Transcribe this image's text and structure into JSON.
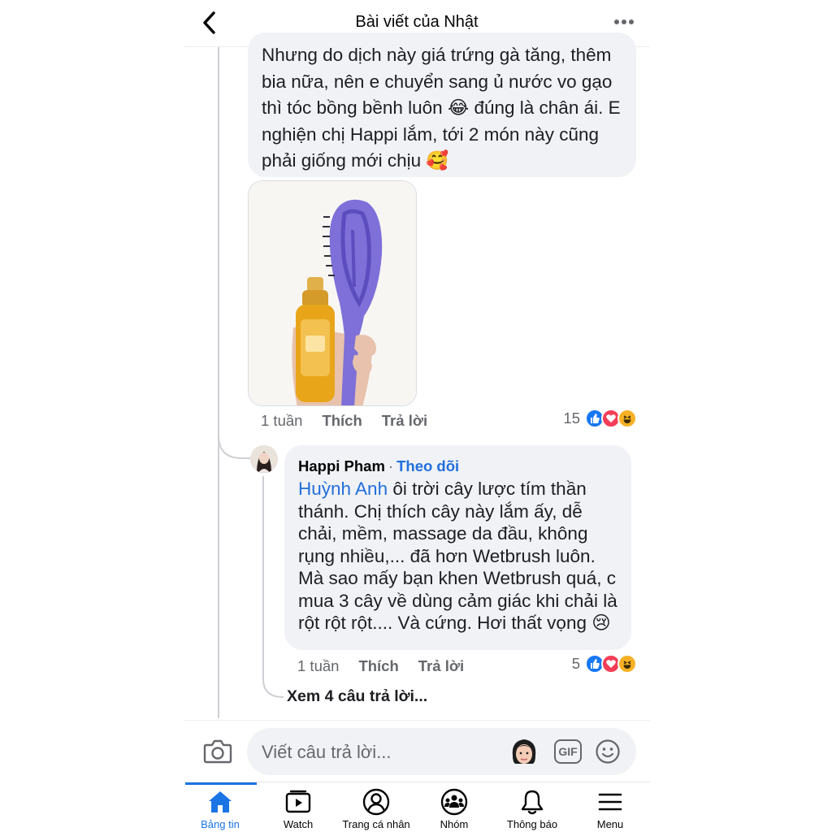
{
  "header": {
    "title": "Bài viết của Nhật",
    "back_icon": "chevron-left-icon",
    "more_icon": "more-horizontal-icon"
  },
  "comment1": {
    "text": "Nhưng do dịch này giá trứng gà tăng, thêm bia nữa, nên e chuyển sang ủ nước vo gạo thì tóc bồng bềnh luôn 😂 đúng là chân ái. E nghiện chị Happi lắm, tới 2 món này cũng phải giống mới chịu 🥰",
    "photo_icon": "photo-hair-oil-and-purple-brush",
    "time": "1 tuần",
    "like_label": "Thích",
    "reply_label": "Trả lời",
    "reaction_count": "15",
    "reactions": [
      "like",
      "love",
      "haha"
    ]
  },
  "comment2": {
    "author": "Happi Pham",
    "separator": "·",
    "follow_label": "Theo dõi",
    "mention": "Huỳnh Anh",
    "text": " ôi trời cây lược tím thần thánh. Chị thích cây này lắm ấy, dễ chải, mềm, massage da đầu, không rụng nhiều,... đã hơn Wetbrush luôn. Mà sao mấy bạn khen Wetbrush quá, c mua 3 cây về dùng cảm giác khi chải là rột rột rột.... Và cứng. Hơi thất vọng 😢",
    "time": "1 tuần",
    "like_label": "Thích",
    "reply_label": "Trả lời",
    "reaction_count": "5",
    "reactions": [
      "like",
      "love",
      "haha"
    ]
  },
  "view_more_replies": "Xem 4 câu trả lời...",
  "composer": {
    "placeholder": "Viết câu trả lời...",
    "camera_icon": "camera-icon",
    "avatar_icon": "avatar-sticker-icon",
    "gif_label": "GIF",
    "emoji_icon": "smiley-icon"
  },
  "tabs": [
    {
      "label": "Bảng tin",
      "icon": "home-icon",
      "active": true
    },
    {
      "label": "Watch",
      "icon": "watch-video-icon",
      "active": false
    },
    {
      "label": "Trang cá nhân",
      "icon": "profile-icon",
      "active": false
    },
    {
      "label": "Nhóm",
      "icon": "groups-icon",
      "active": false
    },
    {
      "label": "Thông báo",
      "icon": "bell-icon",
      "active": false
    },
    {
      "label": "Menu",
      "icon": "menu-icon",
      "active": false
    }
  ],
  "colors": {
    "accent": "#1b74e4",
    "bubble": "#f0f2f5",
    "secondary_text": "#65676b",
    "like": "#1877f2",
    "love": "#f33e58",
    "haha": "#f7b125"
  }
}
